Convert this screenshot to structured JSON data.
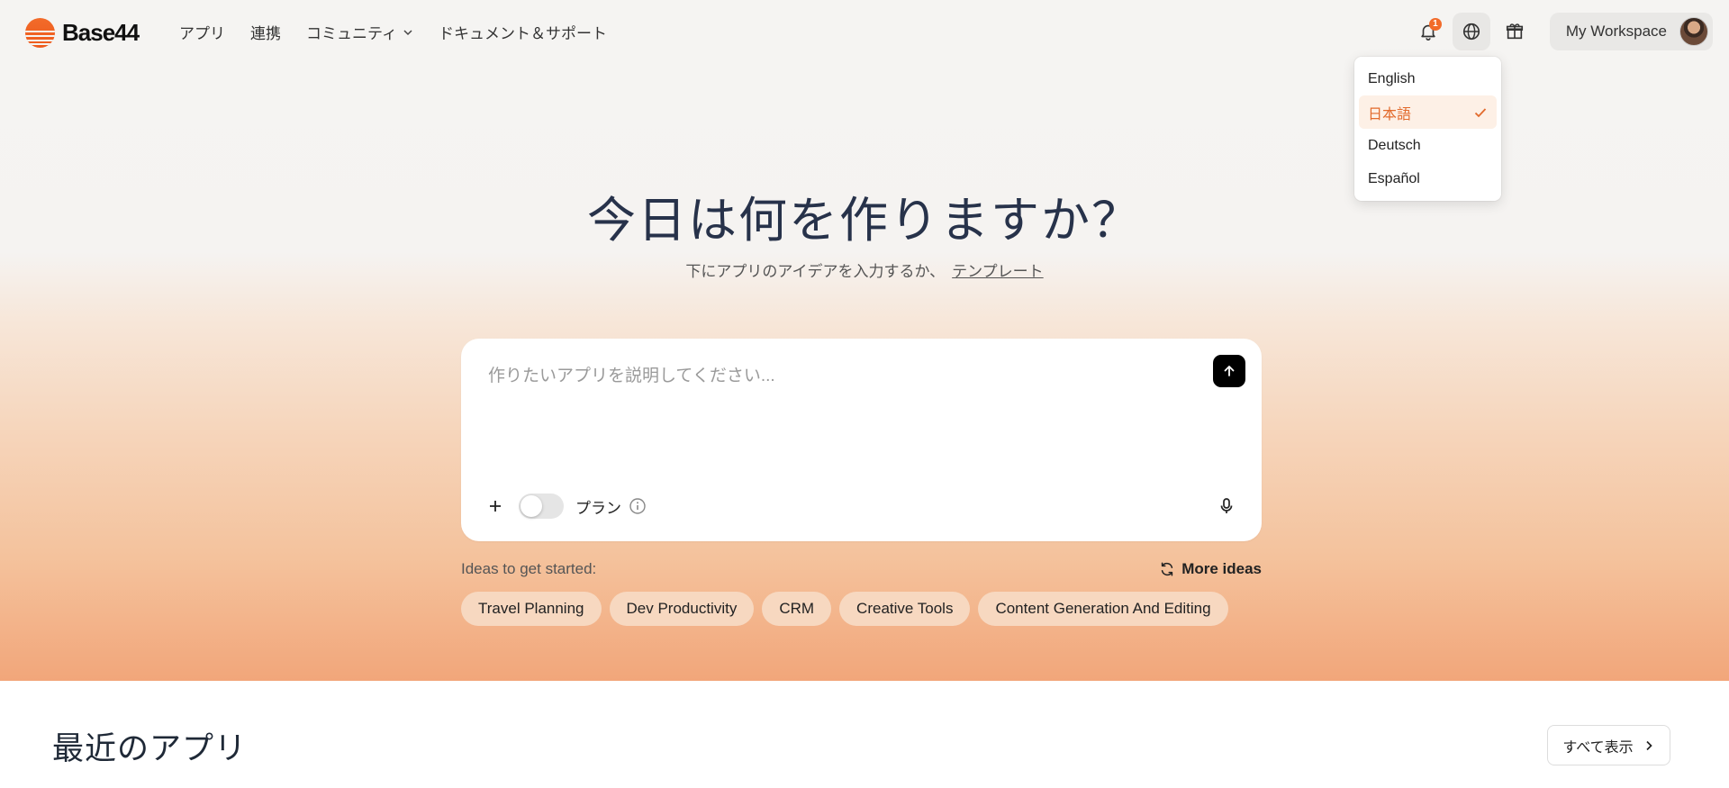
{
  "brand": {
    "name": "Base44",
    "accent": "#f26b2a"
  },
  "nav": {
    "links": [
      {
        "label": "アプリ",
        "has_dropdown": false
      },
      {
        "label": "連携",
        "has_dropdown": false
      },
      {
        "label": "コミュニティ",
        "has_dropdown": true
      },
      {
        "label": "ドキュメント＆サポート",
        "has_dropdown": false
      }
    ],
    "notification_count": "1",
    "workspace_label": "My Workspace"
  },
  "language_menu": {
    "items": [
      "English",
      "日本語",
      "Deutsch",
      "Español"
    ],
    "selected": "日本語"
  },
  "hero": {
    "headline": "今日は何を作りますか？",
    "subline": "下にアプリのアイデアを入力するか、",
    "template_link": "テンプレート"
  },
  "prompt": {
    "placeholder": "作りたいアプリを説明してください...",
    "value": "",
    "plan_label": "プラン",
    "plan_enabled": false
  },
  "ideas": {
    "label": "Ideas to get started:",
    "more_label": "More ideas",
    "chips": [
      "Travel Planning",
      "Dev Productivity",
      "CRM",
      "Creative Tools",
      "Content Generation And Editing"
    ]
  },
  "recent": {
    "title": "最近のアプリ",
    "view_all": "すべて表示"
  }
}
